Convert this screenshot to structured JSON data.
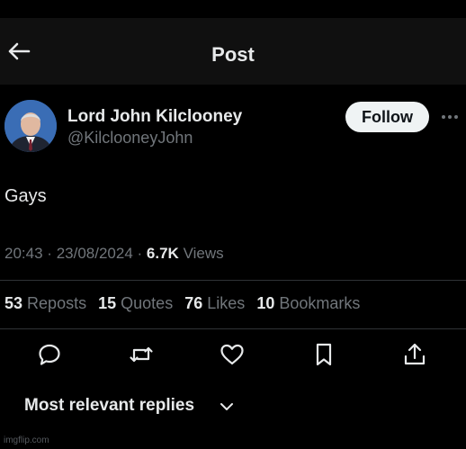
{
  "header": {
    "title": "Post",
    "back_icon": "arrow-left-icon"
  },
  "author": {
    "name": "Lord John Kilclooney",
    "handle": "@KilclooneyJohn",
    "follow_label": "Follow",
    "more_icon": "more-horizontal-icon"
  },
  "post": {
    "text": "Gays",
    "time": "20:43",
    "sep1": "·",
    "date": "23/08/2024",
    "sep2": "·",
    "views_count": "6.7K",
    "views_label": "Views"
  },
  "stats": [
    {
      "count": "53",
      "label": "Reposts"
    },
    {
      "count": "15",
      "label": "Quotes"
    },
    {
      "count": "76",
      "label": "Likes"
    },
    {
      "count": "10",
      "label": "Bookmarks"
    }
  ],
  "actions": [
    "reply-icon",
    "repost-icon",
    "like-icon",
    "bookmark-icon",
    "share-icon"
  ],
  "replies": {
    "sort_label": "Most relevant replies"
  },
  "watermark": "imgflip.com",
  "colors": {
    "background": "#000000",
    "text": "#e7e9ea",
    "muted": "#71767b",
    "follow_bg": "#eff3f4"
  }
}
